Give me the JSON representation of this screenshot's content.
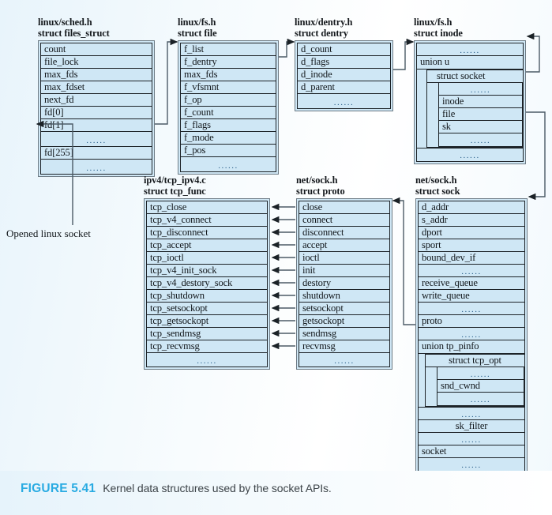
{
  "figure": {
    "number": "FIGURE 5.41",
    "caption": "Kernel data structures used by the socket APIs."
  },
  "side_label": "Opened linux socket",
  "dots": "......",
  "structs": {
    "files_struct": {
      "file": "linux/sched.h",
      "name": "struct files_struct",
      "rows": [
        "count",
        "file_lock",
        "max_fds",
        "max_fdset",
        "next_fd",
        "fd[0]",
        "fd[1]",
        "......",
        "fd[255]",
        "......"
      ]
    },
    "file": {
      "file": "linux/fs.h",
      "name": "struct file",
      "rows": [
        "f_list",
        "f_dentry",
        "max_fds",
        "f_vfsmnt",
        "f_op",
        "f_count",
        "f_flags",
        "f_mode",
        "f_pos",
        "......"
      ]
    },
    "dentry": {
      "file": "linux/dentry.h",
      "name": "struct dentry",
      "rows": [
        "d_count",
        "d_flags",
        "d_inode",
        "d_parent",
        "......"
      ]
    },
    "inode": {
      "file": "linux/fs.h",
      "name": "struct inode",
      "top_dots": "......",
      "union_label": "union u",
      "socket_label": "struct socket",
      "socket_rows": [
        "......",
        "inode",
        "file",
        "sk",
        "......"
      ],
      "bottom_dots": "......"
    },
    "tcp_func": {
      "file": "ipv4/tcp_ipv4.c",
      "name": "struct tcp_func",
      "rows": [
        "tcp_close",
        "tcp_v4_connect",
        "tcp_disconnect",
        "tcp_accept",
        "tcp_ioctl",
        "tcp_v4_init_sock",
        "tcp_v4_destory_sock",
        "tcp_shutdown",
        "tcp_setsockopt",
        "tcp_getsockopt",
        "tcp_sendmsg",
        "tcp_recvmsg",
        "......"
      ]
    },
    "proto": {
      "file": "net/sock.h",
      "name": "struct proto",
      "rows": [
        "close",
        "connect",
        "disconnect",
        "accept",
        "ioctl",
        "init",
        "destory",
        "shutdown",
        "setsockopt",
        "getsockopt",
        "sendmsg",
        "recvmsg",
        "......"
      ]
    },
    "sock": {
      "file": "net/sock.h",
      "name": "struct sock",
      "rows_top": [
        "d_addr",
        "s_addr",
        "dport",
        "sport",
        "bound_dev_if",
        "......",
        "receive_queue",
        "write_queue",
        "......",
        "proto",
        "......"
      ],
      "union_label": "union tp_pinfo",
      "tcp_opt_label": "struct tcp_opt",
      "tcp_opt_rows": [
        "......",
        "snd_cwnd",
        "......"
      ],
      "rows_bottom": [
        "......",
        "sk_filter",
        "......",
        "socket",
        "......"
      ]
    }
  },
  "colors": {
    "row_fill": "#cfe7f5",
    "row_border": "#1d2328",
    "accent": "#29abe2",
    "wire": "#4c5b66"
  }
}
